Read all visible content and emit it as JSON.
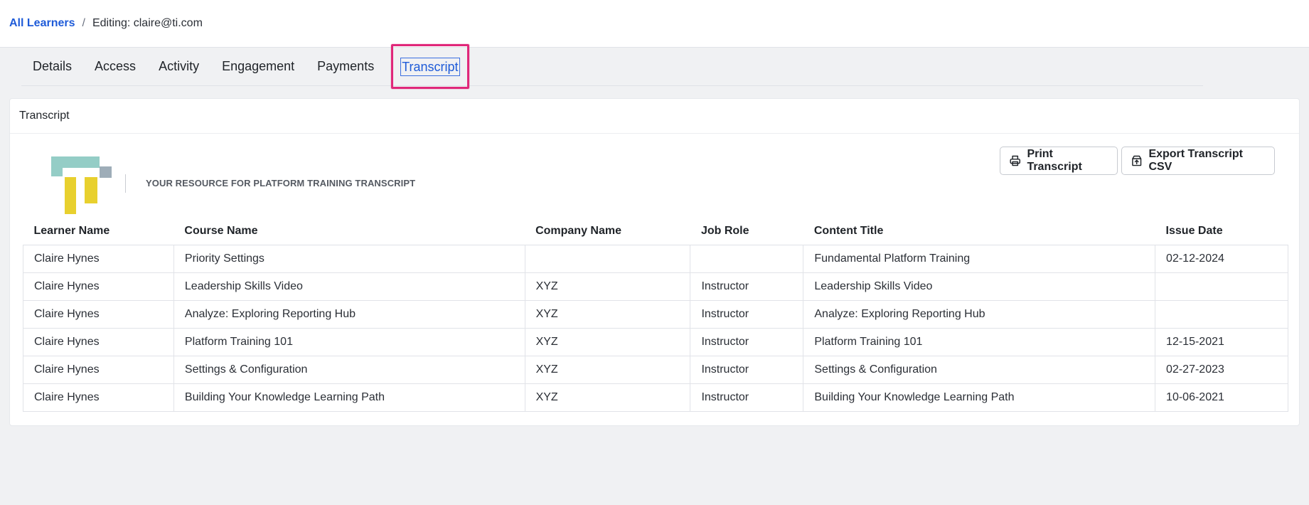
{
  "breadcrumb": {
    "root": "All Learners",
    "separator": "/",
    "current": "Editing: claire@ti.com"
  },
  "tabs": [
    {
      "label": "Details"
    },
    {
      "label": "Access"
    },
    {
      "label": "Activity"
    },
    {
      "label": "Engagement"
    },
    {
      "label": "Payments"
    },
    {
      "label": "Transcript",
      "active": true
    }
  ],
  "card": {
    "title": "Transcript",
    "tagline": "YOUR RESOURCE FOR PLATFORM TRAINING TRANSCRIPT",
    "buttons": {
      "print": "Print Transcript",
      "export": "Export Transcript CSV"
    }
  },
  "table": {
    "headers": [
      "Learner Name",
      "Course Name",
      "Company Name",
      "Job Role",
      "Content Title",
      "Issue Date"
    ],
    "rows": [
      [
        "Claire Hynes",
        "Priority Settings",
        "",
        "",
        "Fundamental Platform Training",
        "02-12-2024"
      ],
      [
        "Claire Hynes",
        "Leadership Skills Video",
        "XYZ",
        "Instructor",
        "Leadership Skills Video",
        ""
      ],
      [
        "Claire Hynes",
        "Analyze: Exploring Reporting Hub",
        "XYZ",
        "Instructor",
        "Analyze: Exploring Reporting Hub",
        ""
      ],
      [
        "Claire Hynes",
        "Platform Training 101",
        "XYZ",
        "Instructor",
        "Platform Training 101",
        "12-15-2021"
      ],
      [
        "Claire Hynes",
        "Settings & Configuration",
        "XYZ",
        "Instructor",
        "Settings & Configuration",
        "02-27-2023"
      ],
      [
        "Claire Hynes",
        "Building Your Knowledge Learning Path",
        "XYZ",
        "Instructor",
        "Building Your Knowledge Learning Path",
        "10-06-2021"
      ]
    ]
  },
  "colors": {
    "link": "#1e5bd8",
    "highlight": "#e0287a",
    "logo_teal": "#94cdc6",
    "logo_yellow": "#e8d02e",
    "logo_gray": "#9eadb8"
  },
  "icons": {
    "print": "printer-icon",
    "export": "export-icon"
  }
}
